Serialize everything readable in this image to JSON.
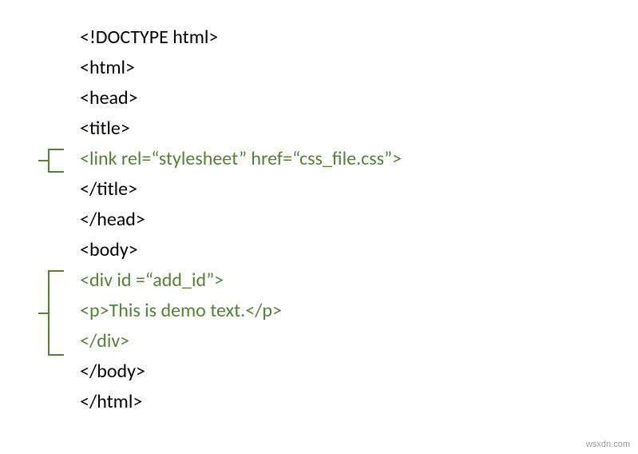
{
  "code": {
    "line1": "<!DOCTYPE html>",
    "line2": "<html>",
    "line3": "<head>",
    "line4": "<title>",
    "line5": "<link rel=“stylesheet” href=“css_file.css”>",
    "line6": "</title>",
    "line7": "</head>",
    "line8": "<body>",
    "line9": "<div id =“add_id”>",
    "line10": "<p>This is demo text.</p>",
    "line11": "</div>",
    "line12": "</body>",
    "line13": "</html>"
  },
  "watermark": "wsxdn.com"
}
